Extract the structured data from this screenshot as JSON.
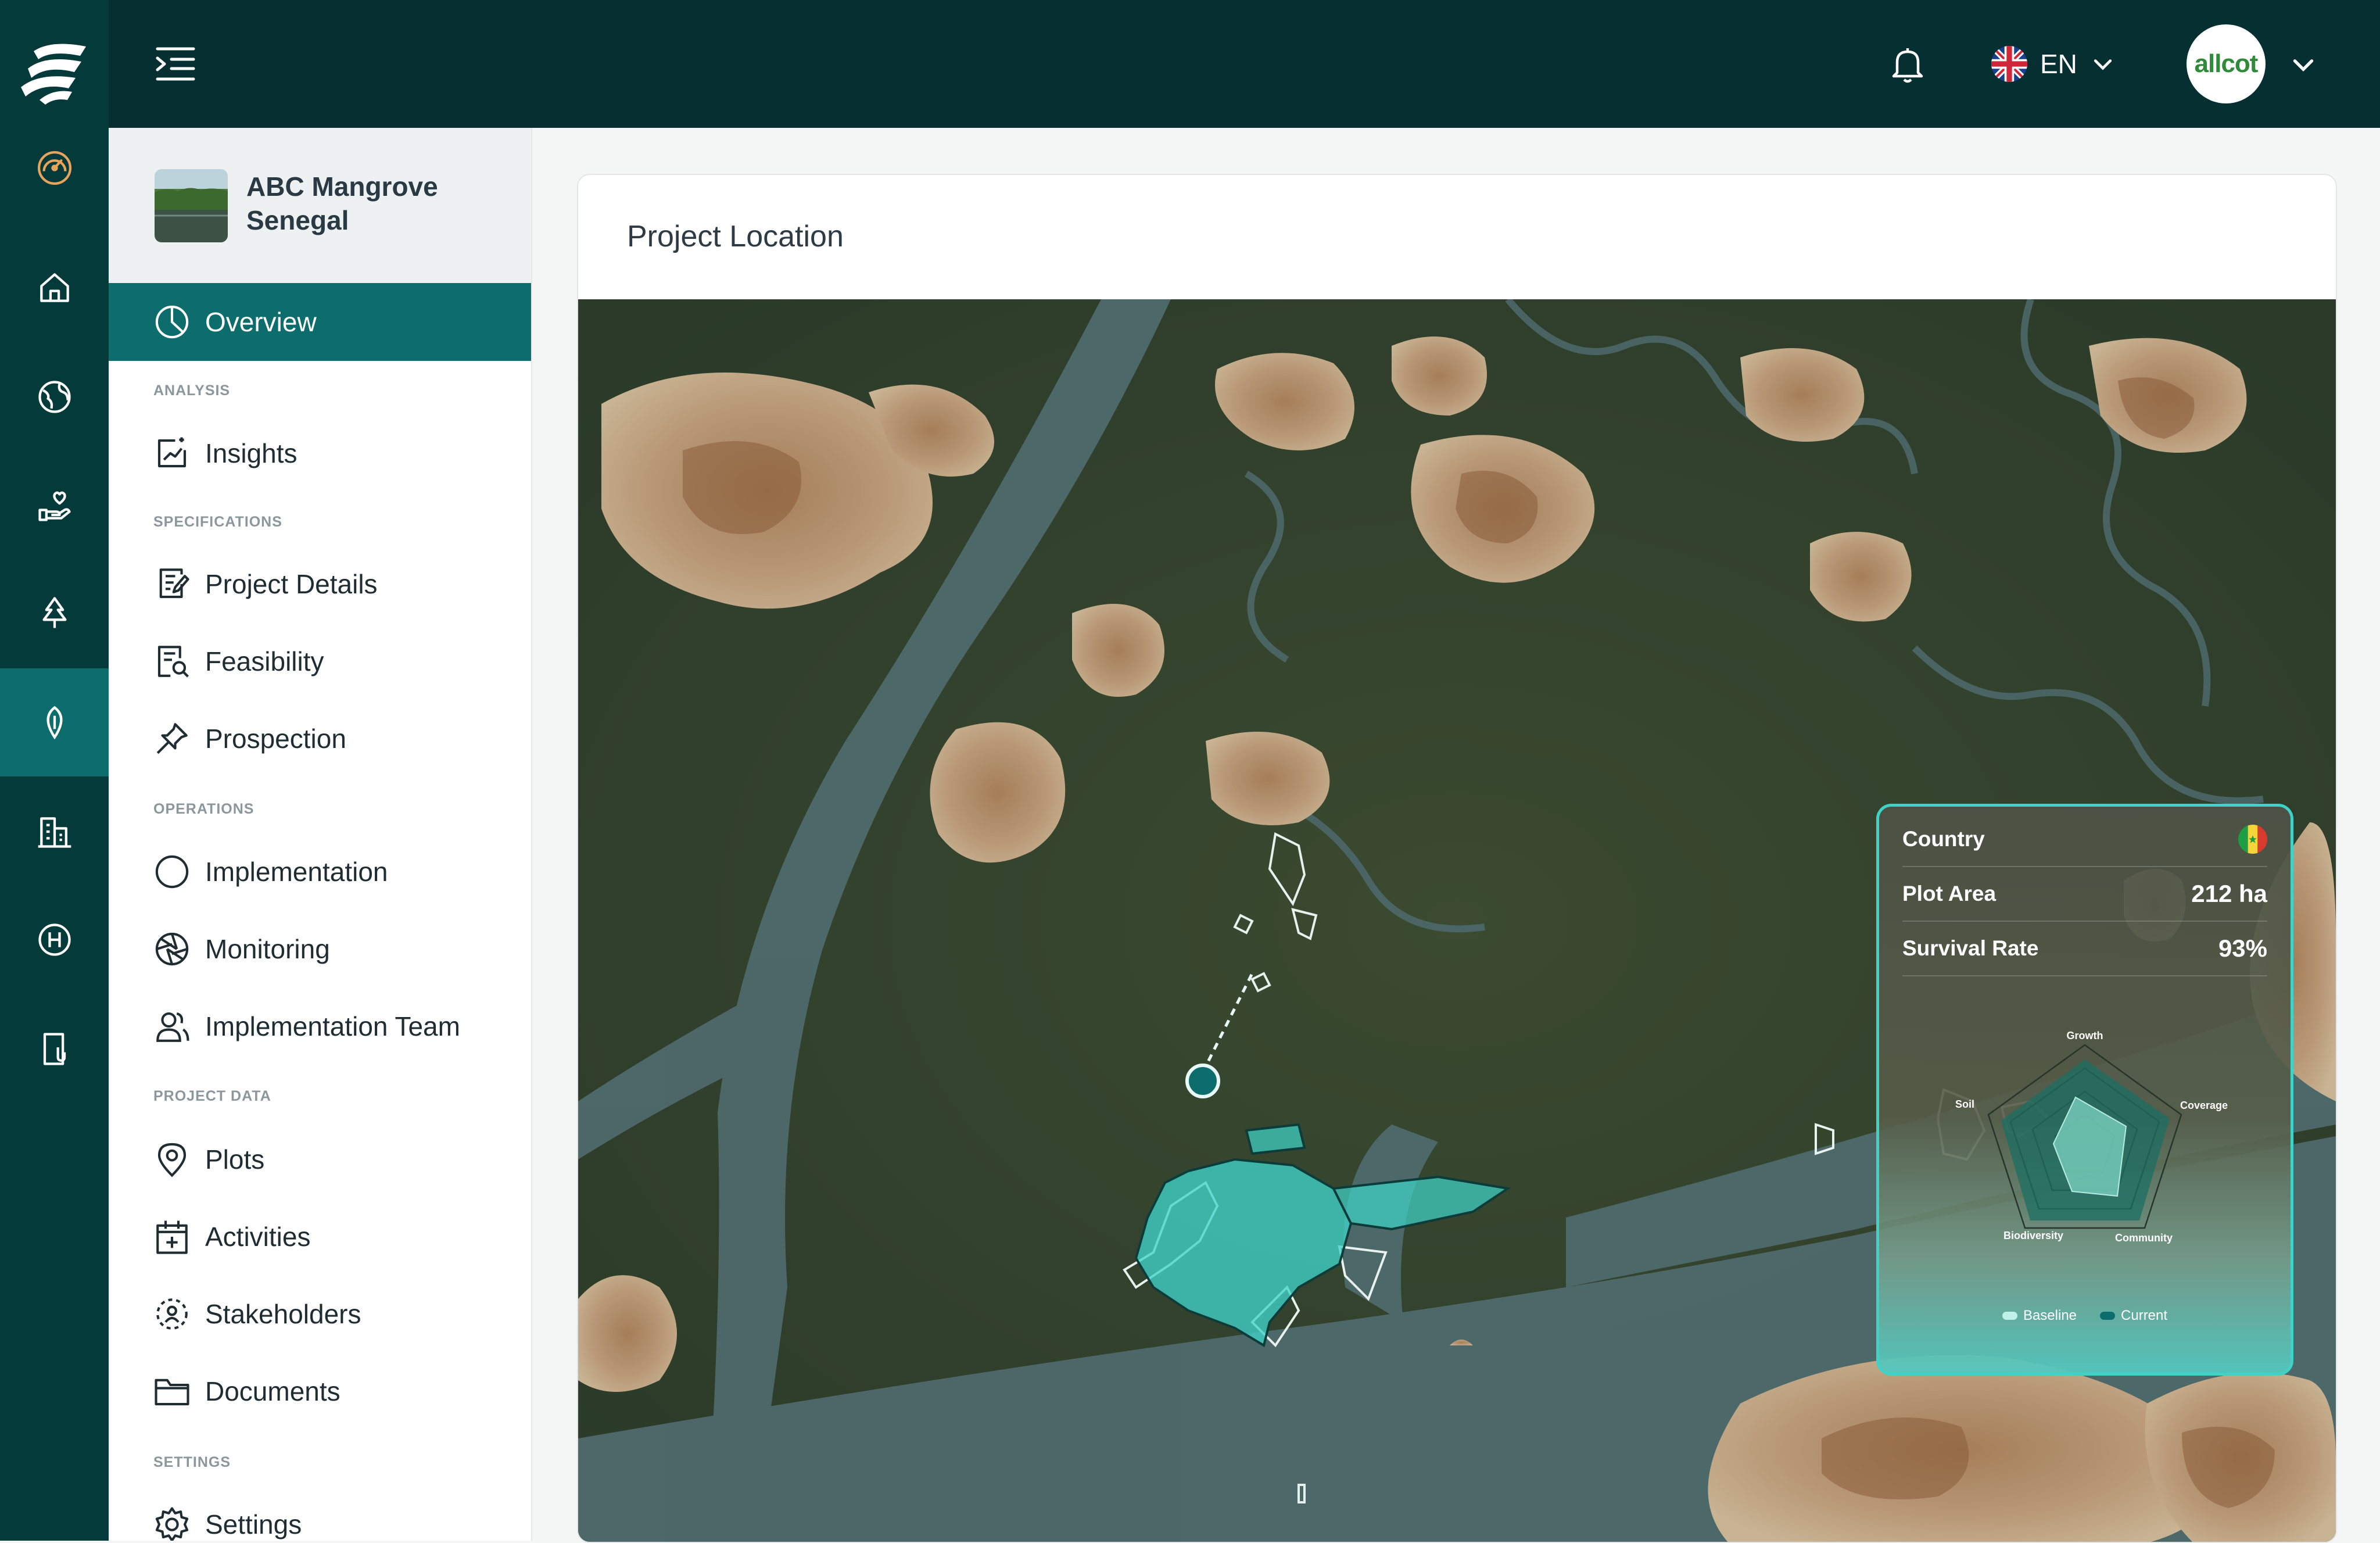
{
  "topbar": {
    "language": "EN",
    "account_logo_text": "allcot"
  },
  "rail": {
    "items": [
      "dashboard-gauge-icon",
      "home-icon",
      "globe-icon",
      "hand-heart-icon",
      "tree-icon",
      "leaf-icon",
      "building-icon",
      "hydrogen-icon",
      "device-icon"
    ],
    "active_index": 5
  },
  "project": {
    "name": "ABC Mangrove Senegal"
  },
  "sidebar": {
    "overview": "Overview",
    "sections": {
      "analysis": "ANALYSIS",
      "specifications": "SPECIFICATIONS",
      "operations": "OPERATIONS",
      "project_data": "PROJECT DATA",
      "settings": "SETTINGS"
    },
    "items": {
      "insights": "Insights",
      "project_details": "Project Details",
      "feasibility": "Feasibility",
      "prospection": "Prospection",
      "implementation": "Implementation",
      "monitoring": "Monitoring",
      "implementation_team": "Implementation Team",
      "plots": "Plots",
      "activities": "Activities",
      "stakeholders": "Stakeholders",
      "documents": "Documents",
      "settings": "Settings"
    }
  },
  "main": {
    "title": "Project Location"
  },
  "popup": {
    "country_label": "Country",
    "plot_area_label": "Plot Area",
    "plot_area_value": "212 ha",
    "survival_rate_label": "Survival Rate",
    "survival_rate_value": "93%",
    "radar": {
      "axes": [
        "Growth",
        "Coverage",
        "Community",
        "Biodiversity",
        "Soil"
      ],
      "legend_baseline": "Baseline",
      "legend_current": "Current"
    }
  },
  "colors": {
    "rail": "#053a3a",
    "topbar": "#062f32",
    "accent": "#0d6d6d",
    "highlight": "#3fd3c8"
  }
}
